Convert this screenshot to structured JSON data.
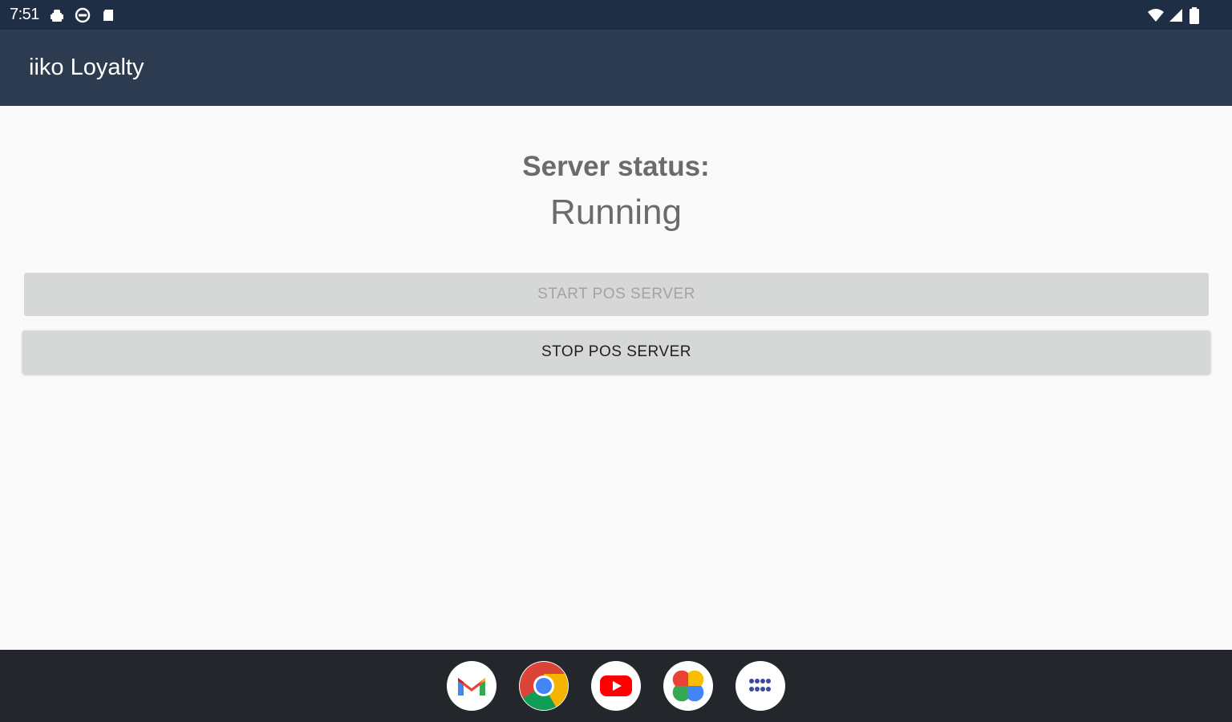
{
  "status_bar": {
    "time": "7:51",
    "icons": [
      "android-debug-icon",
      "data-saver-icon",
      "sd-card-icon",
      "wifi-icon",
      "cell-signal-icon",
      "battery-icon"
    ]
  },
  "app_bar": {
    "title": "iiko Loyalty"
  },
  "main": {
    "status_label": "Server status:",
    "status_value": "Running",
    "start_button": {
      "label": "START POS SERVER",
      "enabled": false
    },
    "stop_button": {
      "label": "STOP POS SERVER",
      "enabled": true
    }
  },
  "taskbar": {
    "apps": [
      "gmail-icon",
      "chrome-icon",
      "youtube-icon",
      "photos-icon",
      "app-drawer-icon"
    ]
  },
  "colors": {
    "status_bar_bg": "#1e2e45",
    "app_bar_bg": "#2c3b4f",
    "content_bg": "#fafafa",
    "button_bg": "#d6d7d7",
    "taskbar_bg": "#23262b"
  }
}
